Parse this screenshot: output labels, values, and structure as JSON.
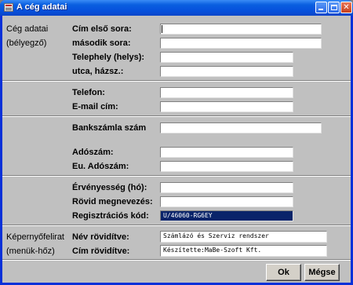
{
  "window": {
    "title": "A cég adatai",
    "minimize_label": "_",
    "maximize_label": "□",
    "close_label": "✕"
  },
  "company": {
    "group_label_line1": "Cég adatai",
    "group_label_line2": "(bélyegző)",
    "fields": [
      {
        "label": "Cím első sora:",
        "value": ""
      },
      {
        "label": "második sora:",
        "value": ""
      },
      {
        "label": "Telephely (helys):",
        "value": ""
      },
      {
        "label": "utca, házsz.:",
        "value": ""
      }
    ]
  },
  "contact": {
    "fields": [
      {
        "label": "Telefon:",
        "value": ""
      },
      {
        "label": "E-mail cím:",
        "value": ""
      }
    ]
  },
  "bank": {
    "account_label": "Bankszámla szám",
    "account_value": "",
    "fields": [
      {
        "label": "Adószám:",
        "value": ""
      },
      {
        "label": "Eu. Adószám:",
        "value": ""
      }
    ]
  },
  "registration": {
    "fields": [
      {
        "label": "Érvényesség (hó):",
        "value": ""
      },
      {
        "label": "Rövid megnevezés:",
        "value": ""
      },
      {
        "label": "Regisztrációs kód:",
        "value": "U/46060-RG6EY"
      }
    ]
  },
  "screen_caption": {
    "group_label_line1": "Képernyőfelirat",
    "group_label_line2": "(menük-hőz)",
    "fields": [
      {
        "label": "Név rövidítve:",
        "value": "  Számlázó és  Szerviz rendszer"
      },
      {
        "label": "Cím rövidítve:",
        "value": "Készítette:MaBe-Szoft Kft."
      }
    ]
  },
  "buttons": {
    "ok_label": "Ok",
    "cancel_label": "Mégse"
  },
  "colors": {
    "titlebar": "#0a5fe0",
    "dialog_background": "#c0c0c0",
    "selected_field": "#0a246a"
  }
}
